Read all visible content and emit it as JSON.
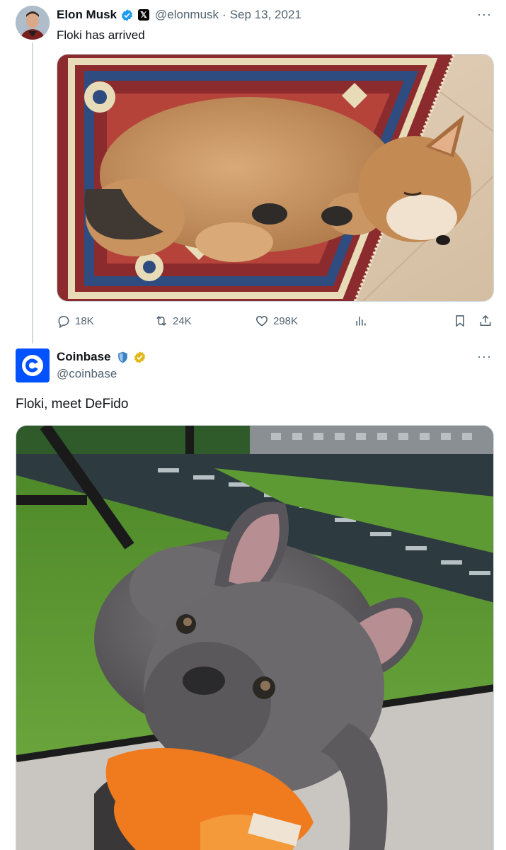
{
  "tweet1": {
    "author_name": "Elon Musk",
    "handle": "@elonmusk",
    "separator": "·",
    "date": "Sep 13, 2021",
    "text": "Floki has arrived",
    "more_label": "···",
    "x_badge": "𝕏",
    "actions": {
      "replies": "18K",
      "retweets": "24K",
      "likes": "298K"
    },
    "icons": {
      "reply": "speech-bubble-icon",
      "retweet": "retweet-arrows-icon",
      "like": "heart-icon",
      "views": "bar-chart-icon",
      "bookmark": "bookmark-icon",
      "share": "upload-share-icon"
    }
  },
  "tweet2": {
    "author_name": "Coinbase",
    "handle": "@coinbase",
    "text": "Floki, meet DeFido",
    "more_label": "···"
  },
  "colors": {
    "verified_blue": "#1d9bf0",
    "verified_gold": "#e2b719",
    "coinbase_blue": "#0052ff",
    "muted": "#536471"
  }
}
